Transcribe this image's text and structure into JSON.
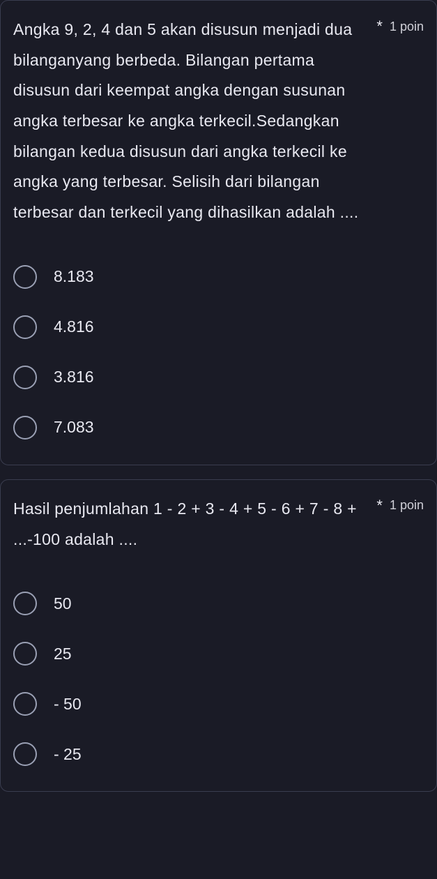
{
  "questions": [
    {
      "text": "Angka 9, 2, 4 dan 5 akan disusun menjadi dua bilanganyang berbeda. Bilangan pertama disusun dari keempat angka dengan susunan angka terbesar ke angka terkecil.Sedangkan bilangan kedua disusun dari angka terkecil ke angka yang terbesar. Selisih dari bilangan terbesar dan terkecil yang dihasilkan adalah ....",
      "required": "*",
      "points": "1 poin",
      "options": [
        "8.183",
        "4.816",
        "3.816",
        "7.083"
      ]
    },
    {
      "text": "Hasil penjumlahan 1 - 2 + 3 - 4 + 5 - 6 + 7 - 8 + ...-100 adalah ....",
      "required": "*",
      "points": "1 poin",
      "options": [
        "50",
        "25",
        "- 50",
        "- 25"
      ]
    }
  ]
}
